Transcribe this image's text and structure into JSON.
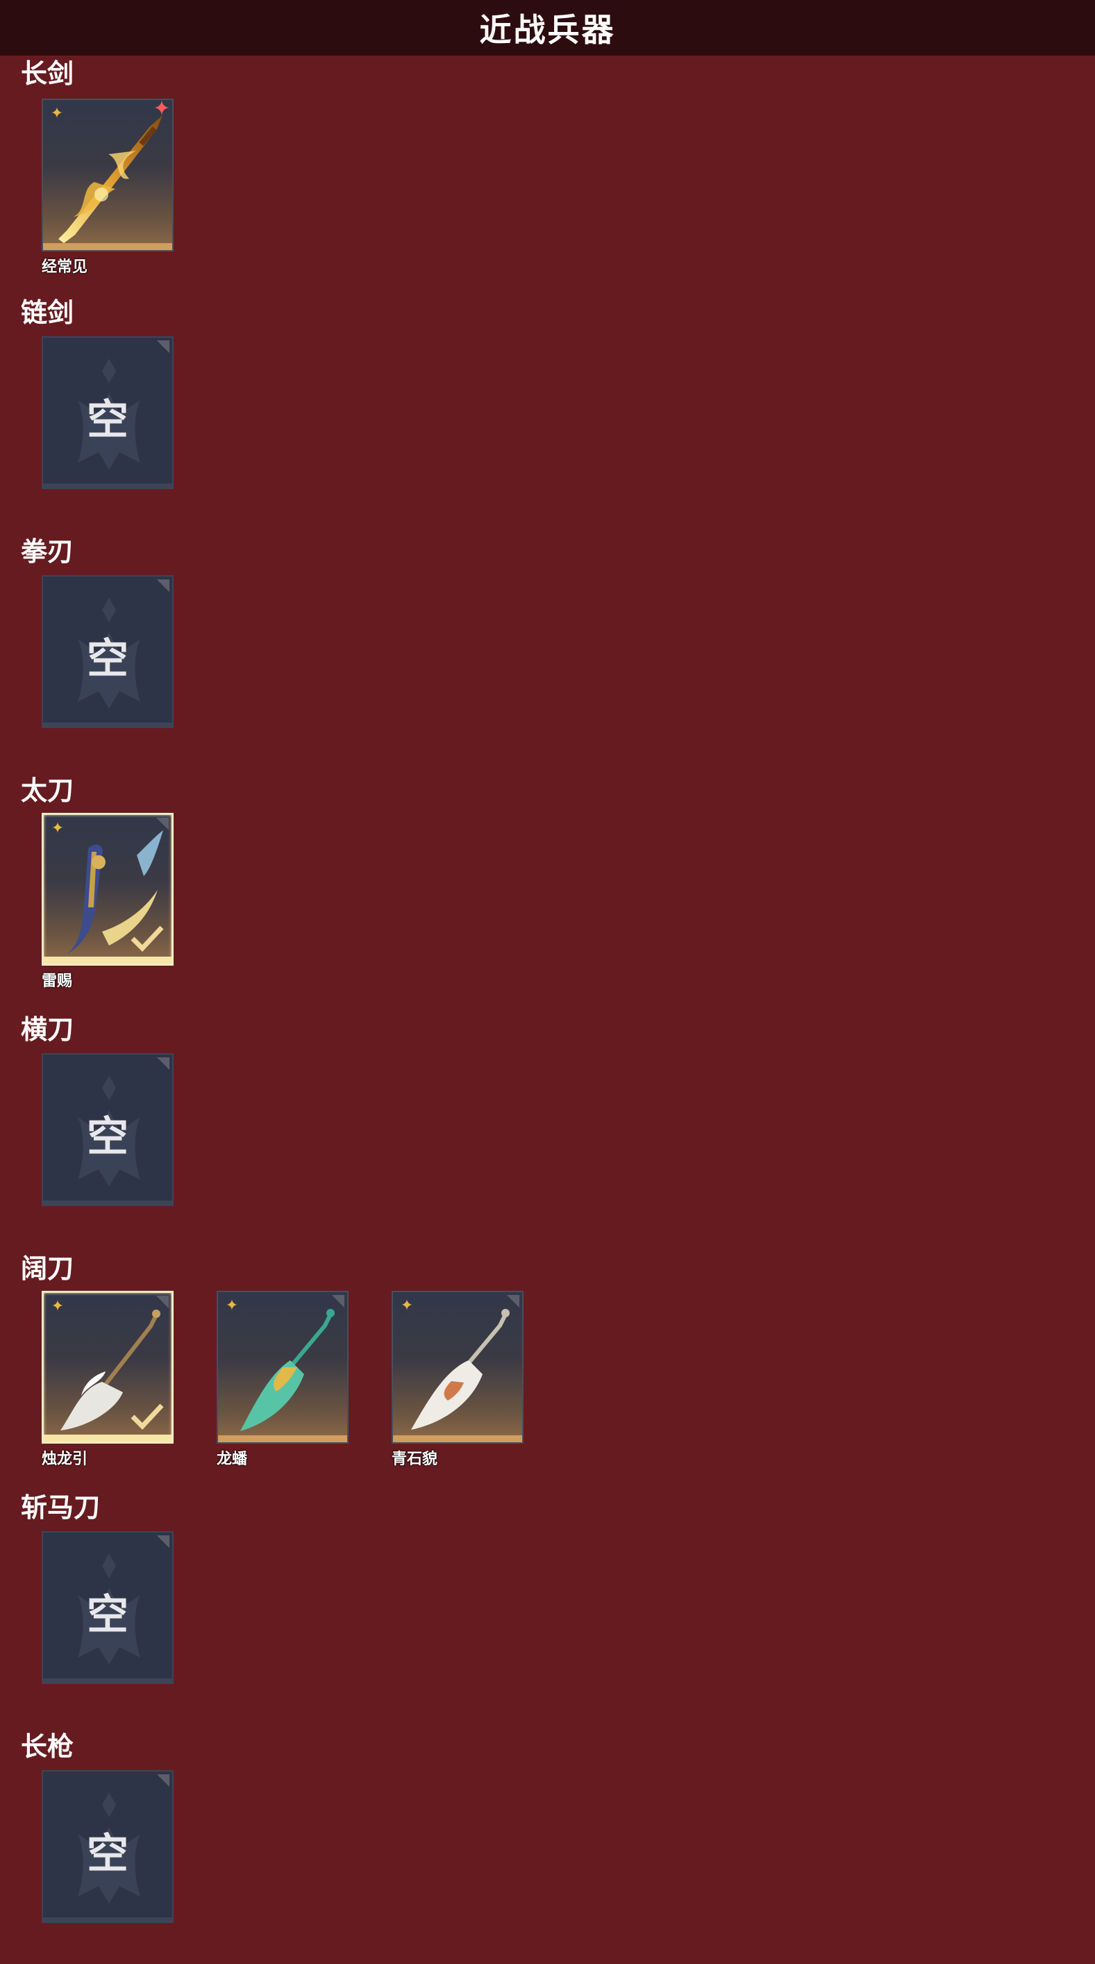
{
  "header": {
    "title": "近战兵器"
  },
  "empty_label": "空",
  "sections": [
    {
      "title": "长剑",
      "items": [
        {
          "name": "经常见",
          "state": "owned",
          "badge": "new",
          "icon": "golden-sword-icon"
        }
      ]
    },
    {
      "title": "链剑",
      "items": [
        {
          "state": "empty"
        }
      ]
    },
    {
      "title": "拳刃",
      "items": [
        {
          "state": "empty"
        }
      ]
    },
    {
      "title": "太刀",
      "items": [
        {
          "name": "雷赐",
          "state": "equipped",
          "icon": "blue-gold-katana-icon"
        }
      ]
    },
    {
      "title": "横刀",
      "items": [
        {
          "state": "empty"
        }
      ]
    },
    {
      "title": "阔刀",
      "items": [
        {
          "name": "烛龙引",
          "state": "equipped",
          "icon": "white-dragon-blade-icon"
        },
        {
          "name": "龙蟠",
          "state": "owned",
          "icon": "jade-dragon-blade-icon"
        },
        {
          "name": "青石貌",
          "state": "owned",
          "icon": "white-beast-blade-icon"
        }
      ]
    },
    {
      "title": "斩马刀",
      "items": [
        {
          "state": "empty"
        }
      ]
    },
    {
      "title": "长枪",
      "items": [
        {
          "state": "empty"
        }
      ]
    }
  ],
  "colors": {
    "background": "#661b20",
    "header_bg": "#2d0c0f",
    "rarity_bar": "#d29d5f",
    "star": "#e8b843",
    "equipped_border": "#f6ecc4"
  }
}
